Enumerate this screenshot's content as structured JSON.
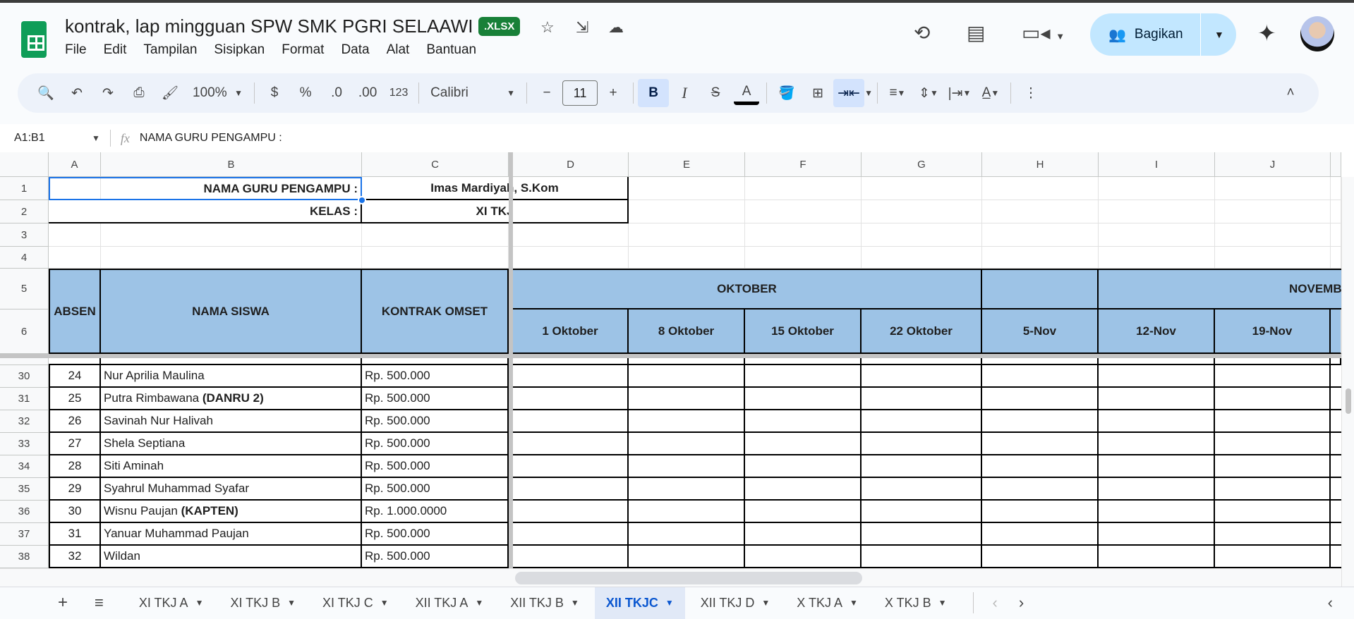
{
  "doc": {
    "title": "kontrak, lap mingguan SPW SMK PGRI SELAAWI",
    "badge": ".XLSX"
  },
  "menu": [
    "File",
    "Edit",
    "Tampilan",
    "Sisipkan",
    "Format",
    "Data",
    "Alat",
    "Bantuan"
  ],
  "share_label": "Bagikan",
  "toolbar": {
    "zoom": "100%",
    "currency": "$",
    "percent": "%",
    "dec_less": ".0",
    "dec_more": ".00",
    "format_123": "123",
    "font": "Calibri",
    "font_size": "11"
  },
  "formula": {
    "name_box": "A1:B1",
    "fx": "fx",
    "value": "NAMA GURU PENGAMPU :"
  },
  "columns": [
    "A",
    "B",
    "C",
    "D",
    "E",
    "F",
    "G",
    "H",
    "I",
    "J"
  ],
  "header_rows": [
    "1",
    "2",
    "3",
    "4",
    "5",
    "6"
  ],
  "info": {
    "guru_label": "NAMA GURU PENGAMPU :",
    "guru_value": "Imas Mardiyah, S.Kom",
    "kelas_label": "KELAS :",
    "kelas_value": "XI TKJ"
  },
  "table_header": {
    "absen": "ABSEN",
    "nama": "NAMA SISWA",
    "kontrak": "KONTRAK OMSET",
    "month1": "OKTOBER",
    "month2": "NOVEMBER",
    "dates": [
      "1 Oktober",
      "8 Oktober",
      "15 Oktober",
      "22 Oktober",
      "5-Nov",
      "12-Nov",
      "19-Nov"
    ]
  },
  "header_fill": "#9dc3e6",
  "rows": [
    {
      "row": "30",
      "absen": "24",
      "name": "Nur Aprilia Maulina",
      "tag": "",
      "kontrak": "Rp. 500.000"
    },
    {
      "row": "31",
      "absen": "25",
      "name": "Putra Rimbawana ",
      "tag": "(DANRU 2)",
      "kontrak": "Rp. 500.000"
    },
    {
      "row": "32",
      "absen": "26",
      "name": "Savinah Nur Halivah",
      "tag": "",
      "kontrak": "Rp. 500.000"
    },
    {
      "row": "33",
      "absen": "27",
      "name": "Shela Septiana",
      "tag": "",
      "kontrak": "Rp. 500.000"
    },
    {
      "row": "34",
      "absen": "28",
      "name": "Siti Aminah",
      "tag": "",
      "kontrak": "Rp. 500.000"
    },
    {
      "row": "35",
      "absen": "29",
      "name": "Syahrul Muhammad Syafar",
      "tag": "",
      "kontrak": "Rp. 500.000"
    },
    {
      "row": "36",
      "absen": "30",
      "name": "Wisnu Paujan ",
      "tag": "(KAPTEN)",
      "kontrak": "Rp. 1.000.0000"
    },
    {
      "row": "37",
      "absen": "31",
      "name": "Yanuar Muhammad Paujan",
      "tag": "",
      "kontrak": "Rp. 500.000"
    },
    {
      "row": "38",
      "absen": "32",
      "name": "Wildan",
      "tag": "",
      "kontrak": "Rp. 500.000"
    }
  ],
  "sheets": [
    "XI TKJ A",
    "XI TKJ B",
    "XI TKJ C",
    "XII TKJ A",
    "XII TKJ B",
    "XII TKJC",
    "XII TKJ D",
    "X TKJ A",
    "X TKJ B"
  ],
  "active_sheet": "XII TKJC"
}
